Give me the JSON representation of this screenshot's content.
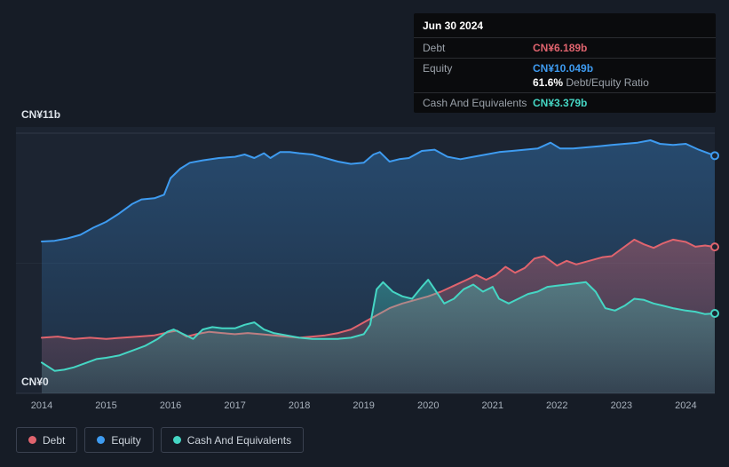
{
  "tooltip": {
    "date": "Jun 30 2024",
    "rows": [
      {
        "label": "Debt",
        "value": "CN¥6.189b",
        "color": "#e0646e"
      },
      {
        "label": "Equity",
        "value": "CN¥10.049b",
        "color": "#3e9bf0"
      },
      {
        "label": "Cash And Equivalents",
        "value": "CN¥3.379b",
        "color": "#45d6c4"
      }
    ],
    "ratio_value": "61.6%",
    "ratio_label": "Debt/Equity Ratio"
  },
  "axis": {
    "y_top": "CN¥11b",
    "y_bottom": "CN¥0"
  },
  "legend": [
    {
      "label": "Debt",
      "color": "#e0646e"
    },
    {
      "label": "Equity",
      "color": "#3e9bf0"
    },
    {
      "label": "Cash And Equivalents",
      "color": "#45d6c4"
    }
  ],
  "chart_data": {
    "type": "area",
    "unit": "CN¥ billions",
    "xlim": [
      2014,
      2024.45
    ],
    "ylim": [
      0,
      11
    ],
    "x_ticks": [
      2014,
      2015,
      2016,
      2017,
      2018,
      2019,
      2020,
      2021,
      2022,
      2023,
      2024
    ],
    "y_ticks": [
      "CN¥0",
      "CN¥11b"
    ],
    "grid_values": [
      0,
      5.5,
      11
    ],
    "legend_position": "bottom-left",
    "series": [
      {
        "name": "Equity",
        "color": "#3e9bf0",
        "current_label": "CN¥10.049b",
        "points": [
          [
            2014,
            6.42
          ],
          [
            2014.2,
            6.45
          ],
          [
            2014.4,
            6.55
          ],
          [
            2014.6,
            6.7
          ],
          [
            2014.8,
            7.0
          ],
          [
            2015,
            7.25
          ],
          [
            2015.2,
            7.6
          ],
          [
            2015.4,
            8.0
          ],
          [
            2015.55,
            8.2
          ],
          [
            2015.75,
            8.25
          ],
          [
            2015.9,
            8.4
          ],
          [
            2016,
            9.1
          ],
          [
            2016.15,
            9.5
          ],
          [
            2016.3,
            9.75
          ],
          [
            2016.5,
            9.85
          ],
          [
            2016.75,
            9.95
          ],
          [
            2017,
            10.0
          ],
          [
            2017.15,
            10.1
          ],
          [
            2017.3,
            9.95
          ],
          [
            2017.45,
            10.15
          ],
          [
            2017.55,
            9.95
          ],
          [
            2017.7,
            10.2
          ],
          [
            2017.85,
            10.2
          ],
          [
            2018,
            10.15
          ],
          [
            2018.2,
            10.1
          ],
          [
            2018.4,
            9.95
          ],
          [
            2018.6,
            9.8
          ],
          [
            2018.8,
            9.7
          ],
          [
            2019,
            9.75
          ],
          [
            2019.15,
            10.1
          ],
          [
            2019.25,
            10.2
          ],
          [
            2019.4,
            9.8
          ],
          [
            2019.55,
            9.9
          ],
          [
            2019.7,
            9.95
          ],
          [
            2019.9,
            10.25
          ],
          [
            2020.1,
            10.3
          ],
          [
            2020.3,
            10.0
          ],
          [
            2020.5,
            9.9
          ],
          [
            2020.7,
            10.0
          ],
          [
            2020.9,
            10.1
          ],
          [
            2021.1,
            10.2
          ],
          [
            2021.3,
            10.25
          ],
          [
            2021.5,
            10.3
          ],
          [
            2021.7,
            10.35
          ],
          [
            2021.9,
            10.6
          ],
          [
            2022.05,
            10.35
          ],
          [
            2022.25,
            10.35
          ],
          [
            2022.45,
            10.4
          ],
          [
            2022.65,
            10.45
          ],
          [
            2022.85,
            10.5
          ],
          [
            2023.05,
            10.55
          ],
          [
            2023.25,
            10.6
          ],
          [
            2023.45,
            10.7
          ],
          [
            2023.6,
            10.55
          ],
          [
            2023.8,
            10.5
          ],
          [
            2024,
            10.55
          ],
          [
            2024.2,
            10.3
          ],
          [
            2024.45,
            10.049
          ]
        ]
      },
      {
        "name": "Debt",
        "color": "#e0646e",
        "current_label": "CN¥6.189b",
        "points": [
          [
            2014,
            2.35
          ],
          [
            2014.25,
            2.4
          ],
          [
            2014.5,
            2.3
          ],
          [
            2014.75,
            2.35
          ],
          [
            2015,
            2.3
          ],
          [
            2015.25,
            2.35
          ],
          [
            2015.5,
            2.4
          ],
          [
            2015.75,
            2.45
          ],
          [
            2016,
            2.6
          ],
          [
            2016.1,
            2.65
          ],
          [
            2016.25,
            2.4
          ],
          [
            2016.4,
            2.5
          ],
          [
            2016.6,
            2.6
          ],
          [
            2016.8,
            2.55
          ],
          [
            2017,
            2.5
          ],
          [
            2017.2,
            2.55
          ],
          [
            2017.4,
            2.5
          ],
          [
            2017.6,
            2.45
          ],
          [
            2017.8,
            2.4
          ],
          [
            2018,
            2.35
          ],
          [
            2018.2,
            2.4
          ],
          [
            2018.4,
            2.45
          ],
          [
            2018.6,
            2.55
          ],
          [
            2018.8,
            2.7
          ],
          [
            2019,
            3.0
          ],
          [
            2019.2,
            3.3
          ],
          [
            2019.4,
            3.6
          ],
          [
            2019.6,
            3.8
          ],
          [
            2019.8,
            3.95
          ],
          [
            2020,
            4.1
          ],
          [
            2020.2,
            4.3
          ],
          [
            2020.4,
            4.55
          ],
          [
            2020.6,
            4.8
          ],
          [
            2020.75,
            5.0
          ],
          [
            2020.9,
            4.8
          ],
          [
            2021.05,
            5.0
          ],
          [
            2021.2,
            5.35
          ],
          [
            2021.35,
            5.1
          ],
          [
            2021.5,
            5.3
          ],
          [
            2021.65,
            5.7
          ],
          [
            2021.8,
            5.8
          ],
          [
            2022,
            5.4
          ],
          [
            2022.15,
            5.6
          ],
          [
            2022.3,
            5.45
          ],
          [
            2022.5,
            5.6
          ],
          [
            2022.7,
            5.75
          ],
          [
            2022.85,
            5.8
          ],
          [
            2023,
            6.1
          ],
          [
            2023.2,
            6.5
          ],
          [
            2023.35,
            6.3
          ],
          [
            2023.5,
            6.15
          ],
          [
            2023.65,
            6.35
          ],
          [
            2023.8,
            6.5
          ],
          [
            2024,
            6.4
          ],
          [
            2024.15,
            6.2
          ],
          [
            2024.3,
            6.25
          ],
          [
            2024.45,
            6.189
          ]
        ]
      },
      {
        "name": "Cash And Equivalents",
        "color": "#45d6c4",
        "current_label": "CN¥3.379b",
        "points": [
          [
            2014,
            1.3
          ],
          [
            2014.2,
            0.95
          ],
          [
            2014.35,
            1.0
          ],
          [
            2014.5,
            1.1
          ],
          [
            2014.7,
            1.3
          ],
          [
            2014.85,
            1.45
          ],
          [
            2015,
            1.5
          ],
          [
            2015.2,
            1.6
          ],
          [
            2015.4,
            1.8
          ],
          [
            2015.6,
            2.0
          ],
          [
            2015.8,
            2.3
          ],
          [
            2015.95,
            2.6
          ],
          [
            2016.05,
            2.7
          ],
          [
            2016.2,
            2.5
          ],
          [
            2016.35,
            2.3
          ],
          [
            2016.5,
            2.7
          ],
          [
            2016.65,
            2.8
          ],
          [
            2016.8,
            2.75
          ],
          [
            2017,
            2.75
          ],
          [
            2017.15,
            2.9
          ],
          [
            2017.3,
            3.0
          ],
          [
            2017.45,
            2.7
          ],
          [
            2017.6,
            2.55
          ],
          [
            2017.8,
            2.45
          ],
          [
            2018,
            2.35
          ],
          [
            2018.2,
            2.3
          ],
          [
            2018.4,
            2.3
          ],
          [
            2018.6,
            2.3
          ],
          [
            2018.8,
            2.35
          ],
          [
            2019,
            2.5
          ],
          [
            2019.1,
            2.9
          ],
          [
            2019.2,
            4.4
          ],
          [
            2019.3,
            4.7
          ],
          [
            2019.45,
            4.3
          ],
          [
            2019.6,
            4.1
          ],
          [
            2019.75,
            4.0
          ],
          [
            2019.9,
            4.5
          ],
          [
            2020,
            4.8
          ],
          [
            2020.1,
            4.4
          ],
          [
            2020.25,
            3.8
          ],
          [
            2020.4,
            4.0
          ],
          [
            2020.55,
            4.4
          ],
          [
            2020.7,
            4.6
          ],
          [
            2020.85,
            4.3
          ],
          [
            2021,
            4.5
          ],
          [
            2021.1,
            4.0
          ],
          [
            2021.25,
            3.8
          ],
          [
            2021.4,
            4.0
          ],
          [
            2021.55,
            4.2
          ],
          [
            2021.7,
            4.3
          ],
          [
            2021.85,
            4.5
          ],
          [
            2022,
            4.55
          ],
          [
            2022.15,
            4.6
          ],
          [
            2022.3,
            4.65
          ],
          [
            2022.45,
            4.7
          ],
          [
            2022.6,
            4.3
          ],
          [
            2022.75,
            3.6
          ],
          [
            2022.9,
            3.5
          ],
          [
            2023.05,
            3.7
          ],
          [
            2023.2,
            4.0
          ],
          [
            2023.35,
            3.95
          ],
          [
            2023.5,
            3.8
          ],
          [
            2023.65,
            3.7
          ],
          [
            2023.8,
            3.6
          ],
          [
            2024,
            3.5
          ],
          [
            2024.15,
            3.45
          ],
          [
            2024.3,
            3.35
          ],
          [
            2024.45,
            3.379
          ]
        ]
      }
    ]
  }
}
